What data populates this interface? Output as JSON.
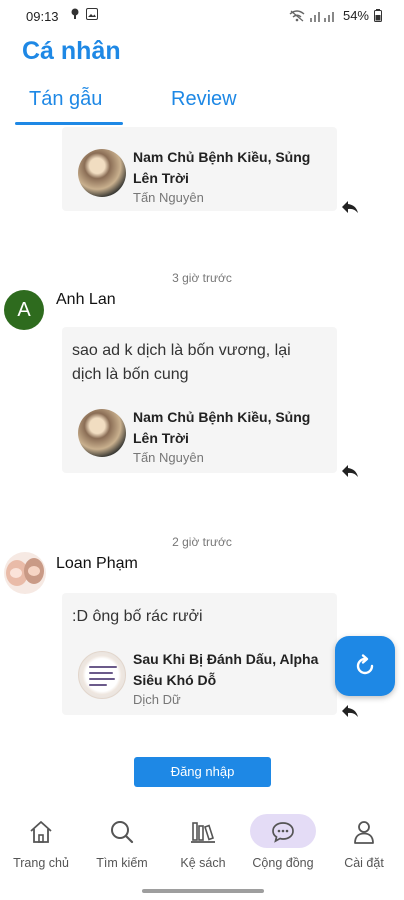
{
  "status_bar": {
    "time": "09:13",
    "battery": "54%",
    "icons": [
      "notification-dot-icon",
      "image-icon",
      "wifi-off-icon",
      "signal-icon",
      "battery-icon"
    ]
  },
  "header": {
    "title": "Cá nhân"
  },
  "tabs": [
    {
      "label": "Tán gẫu",
      "active": true
    },
    {
      "label": "Review",
      "active": false
    }
  ],
  "posts": [
    {
      "book": {
        "title": "Nam Chủ Bệnh Kiều, Sủng Lên Trời",
        "author": "Tấn Nguyên"
      }
    },
    {
      "time": "3 giờ trước",
      "user": {
        "name": "Anh Lan",
        "initial": "A"
      },
      "message": "sao ad k dịch là bốn vương, lại dịch là bốn cung",
      "book": {
        "title": "Nam Chủ Bệnh Kiều, Sủng Lên Trời",
        "author": "Tấn Nguyên"
      }
    },
    {
      "time": "2 giờ trước",
      "user": {
        "name": "Loan Phạm"
      },
      "message": ":D ông bố rác rưởi",
      "book": {
        "title": "Sau Khi Bị Đánh Dấu, Alpha Siêu Khó Dỗ",
        "author": "Dịch Dữ"
      }
    }
  ],
  "login_button": "Đăng nhập",
  "bottom_nav": [
    {
      "label": "Trang chủ",
      "icon": "home-icon"
    },
    {
      "label": "Tìm kiếm",
      "icon": "search-icon"
    },
    {
      "label": "Kệ sách",
      "icon": "bookshelf-icon"
    },
    {
      "label": "Cộng đồng",
      "icon": "chat-bubble-icon",
      "active": true
    },
    {
      "label": "Cài đặt",
      "icon": "user-icon"
    }
  ],
  "colors": {
    "accent": "#1e88e5",
    "active_nav_pill": "#e4dcf6",
    "avatar_green": "#2e6b1e"
  }
}
